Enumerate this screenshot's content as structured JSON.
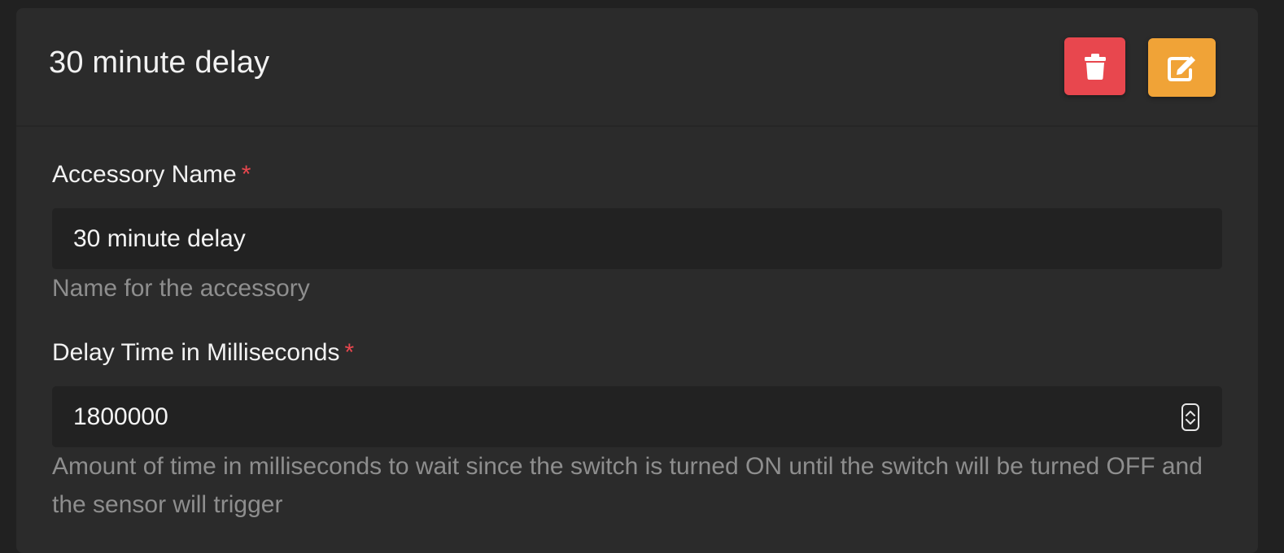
{
  "card": {
    "title": "30 minute delay"
  },
  "buttons": {
    "delete_icon": "trash-icon",
    "edit_icon": "edit-icon",
    "delete_color": "#e8474e",
    "edit_color": "#f0a337"
  },
  "fields": [
    {
      "label": "Accessory Name",
      "required_mark": "*",
      "value": "30 minute delay",
      "help": "Name for the accessory"
    },
    {
      "label": "Delay Time in Milliseconds",
      "required_mark": "*",
      "value": "1800000",
      "help": "Amount of time in milliseconds to wait since the switch is turned ON until the switch will be turned OFF and the sensor will trigger"
    }
  ]
}
